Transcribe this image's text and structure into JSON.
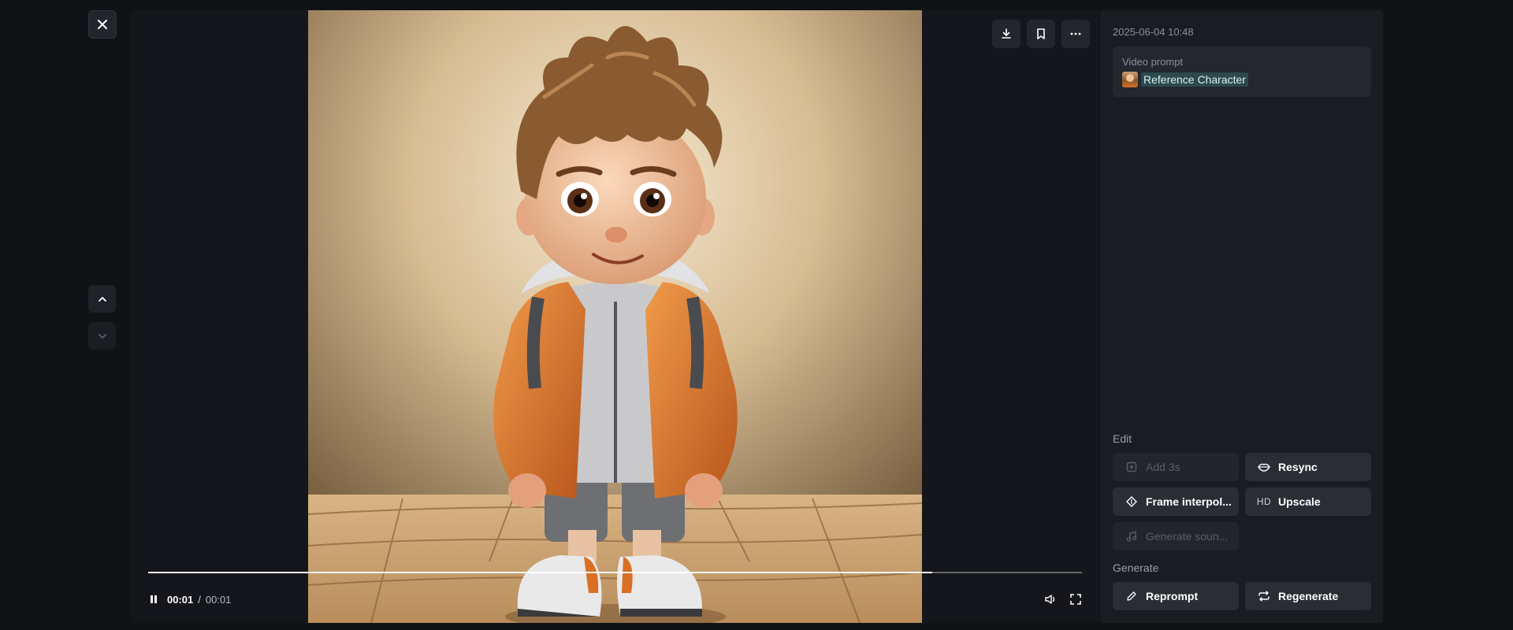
{
  "toolbar": {
    "close_icon": "close-icon",
    "up_icon": "chevron-up-icon",
    "down_icon": "chevron-down-icon",
    "download_icon": "download-icon",
    "bookmark_icon": "bookmark-icon",
    "more_icon": "more-horizontal-icon"
  },
  "player": {
    "current_time": "00:01",
    "separator": "/",
    "duration": "00:01",
    "progress": 0.84
  },
  "details": {
    "timestamp": "2025-06-04 10:48",
    "prompt_label": "Video prompt",
    "reference_chip": "Reference Character"
  },
  "edit": {
    "label": "Edit",
    "add3s": "Add 3s",
    "resync": "Resync",
    "frame_interp": "Frame interpol...",
    "upscale_badge": "HD",
    "upscale": "Upscale",
    "generate_sound": "Generate soun..."
  },
  "generate": {
    "label": "Generate",
    "reprompt": "Reprompt",
    "regenerate": "Regenerate"
  },
  "colors": {
    "background": "#101216",
    "panel": "#1a1c22",
    "button": "#2a2d34",
    "accent_chip": "#3c8c87"
  }
}
